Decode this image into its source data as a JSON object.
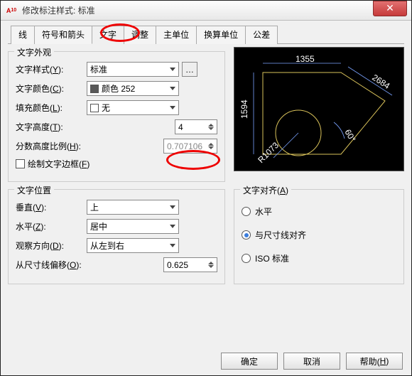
{
  "window": {
    "title": "修改标注样式: 标准"
  },
  "tabs": [
    "线",
    "符号和箭头",
    "文字",
    "调整",
    "主单位",
    "换算单位",
    "公差"
  ],
  "active_tab_index": 2,
  "appearance": {
    "title": "文字外观",
    "style_label": "文字样式(Y):",
    "style_value": "标准",
    "color_label": "文字颜色(C):",
    "color_value": "颜色 252",
    "fill_label": "填充颜色(L):",
    "fill_value": "无",
    "height_label": "文字高度(T):",
    "height_value": "4",
    "frac_label": "分数高度比例(H):",
    "frac_value": "0.707106",
    "frame_label": "绘制文字边框(F)"
  },
  "placement": {
    "title": "文字位置",
    "vert_label": "垂直(V):",
    "vert_value": "上",
    "horiz_label": "水平(Z):",
    "horiz_value": "居中",
    "viewdir_label": "观察方向(D):",
    "viewdir_value": "从左到右",
    "offset_label": "从尺寸线偏移(O):",
    "offset_value": "0.625"
  },
  "alignment": {
    "title": "文字对齐(A)",
    "opt1": "水平",
    "opt2": "与尺寸线对齐",
    "opt3": "ISO 标准",
    "selected": 2
  },
  "preview_dims": {
    "top": "1355",
    "left": "1594",
    "diag": "2684",
    "arc": "60",
    "radius": "R1073"
  },
  "buttons": {
    "ok": "确定",
    "cancel": "取消",
    "help": "帮助(H)"
  }
}
